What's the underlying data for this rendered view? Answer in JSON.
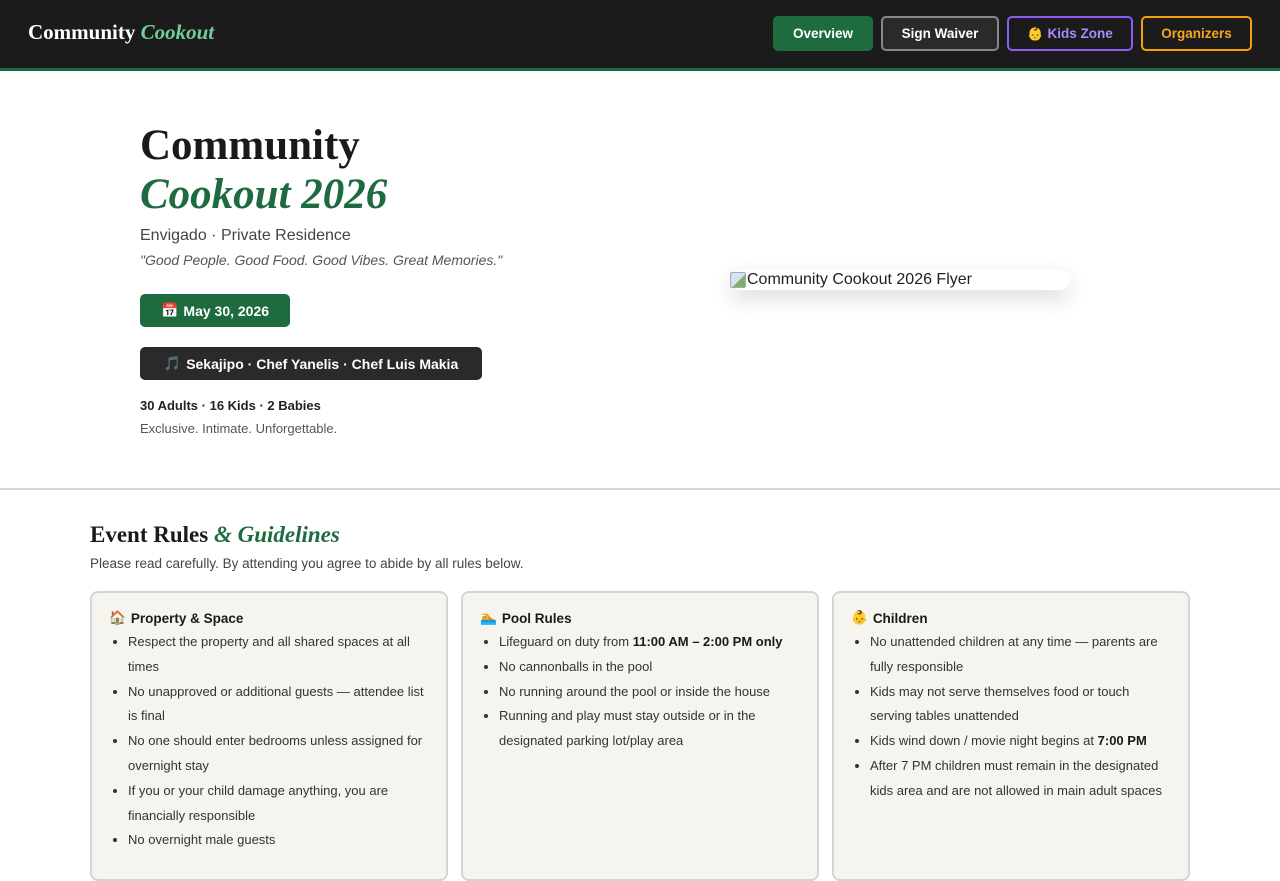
{
  "nav": {
    "brand_main": "Community",
    "brand_accent": "Cookout",
    "buttons": {
      "overview": "Overview",
      "waiver": "Sign Waiver",
      "kids_icon": "👶",
      "kids": "Kids Zone",
      "organizers": "Organizers"
    }
  },
  "hero": {
    "title_line1": "Community",
    "title_line2": "Cookout 2026",
    "location": "Envigado · Private Residence",
    "quote": "\"Good People. Good Food. Good Vibes. Great Memories.\"",
    "date_icon": "📅",
    "date": "May 30, 2026",
    "performers_icon": "🎵",
    "performers": "Sekajipo · Chef Yanelis · Chef Luis Makia",
    "attendance": "30 Adults · 16 Kids · 2 Babies",
    "tagline": "Exclusive. Intimate. Unforgettable.",
    "flyer_alt": "Community Cookout 2026 Flyer"
  },
  "rules": {
    "title_main": "Event Rules",
    "title_accent": "& Guidelines",
    "subtitle": "Please read carefully. By attending you agree to abide by all rules below.",
    "cards": {
      "property": {
        "icon": "🏠",
        "title": "Property & Space",
        "items": [
          "Respect the property and all shared spaces at all times",
          "No unapproved or additional guests — attendee list is final",
          "No one should enter bedrooms unless assigned for overnight stay",
          "If you or your child damage anything, you are financially responsible",
          "No overnight male guests"
        ]
      },
      "pool": {
        "icon": "🏊",
        "title": "Pool Rules",
        "item1_pre": "Lifeguard on duty from ",
        "item1_bold": "11:00 AM – 2:00 PM only",
        "items": [
          "No cannonballs in the pool",
          "No running around the pool or inside the house",
          "Running and play must stay outside or in the designated parking lot/play area"
        ]
      },
      "children": {
        "icon": "👶",
        "title": "Children",
        "items": [
          "No unattended children at any time — parents are fully responsible",
          "Kids may not serve themselves food or touch serving tables unattended"
        ],
        "item3_pre": "Kids wind down / movie night begins at ",
        "item3_bold": "7:00 PM",
        "item4": "After 7 PM children must remain in the designated kids area and are not allowed in main adult spaces"
      }
    }
  }
}
